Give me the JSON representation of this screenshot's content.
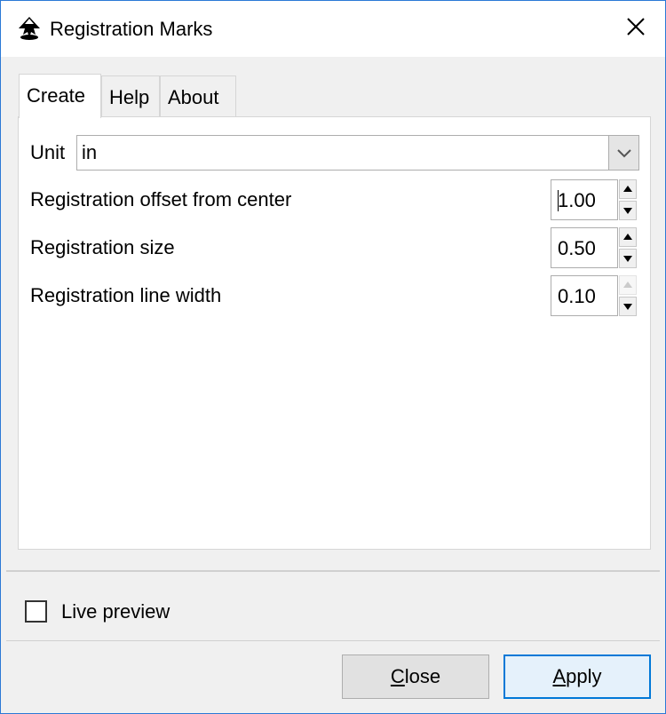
{
  "window": {
    "title": "Registration Marks",
    "app_icon": "inkscape-icon",
    "close_icon": "close-icon"
  },
  "tabs": [
    {
      "label": "Create",
      "active": true
    },
    {
      "label": "Help",
      "active": false
    },
    {
      "label": "About",
      "active": false
    }
  ],
  "create": {
    "unit_label": "Unit",
    "unit_value": "in",
    "fields": [
      {
        "label": "Registration offset from center",
        "value": "1.00"
      },
      {
        "label": "Registration size",
        "value": "0.50"
      },
      {
        "label": "Registration line width",
        "value": "0.10"
      }
    ]
  },
  "live_preview": {
    "label": "Live preview",
    "checked": false
  },
  "buttons": {
    "close_mnemonic": "C",
    "close_rest": "lose",
    "apply_mnemonic": "A",
    "apply_rest": "pply"
  },
  "colors": {
    "accent": "#0078d7",
    "window_border": "#2b79d6"
  }
}
